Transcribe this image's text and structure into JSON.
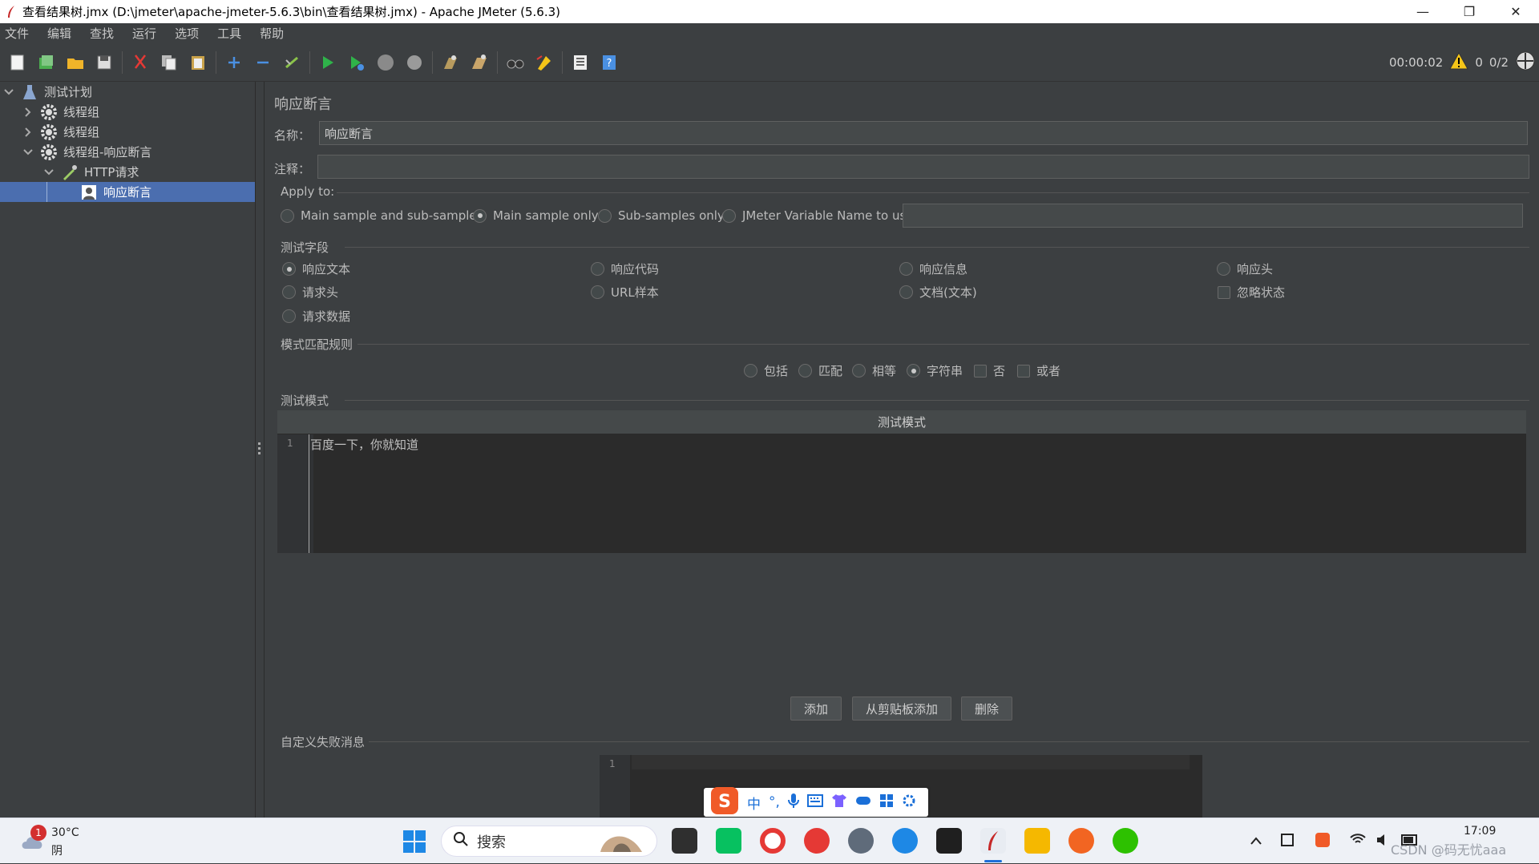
{
  "window": {
    "title": "查看结果树.jmx (D:\\jmeter\\apache-jmeter-5.6.3\\bin\\查看结果树.jmx) - Apache JMeter (5.6.3)",
    "minimize": "—",
    "maximize": "❐",
    "close": "✕"
  },
  "menu": [
    "文件",
    "编辑",
    "查找",
    "运行",
    "选项",
    "工具",
    "帮助"
  ],
  "toolbar_status": {
    "elapsed": "00:00:02",
    "warnings": "0",
    "threads": "0/2"
  },
  "tree": {
    "items": [
      {
        "label": "测试计划"
      },
      {
        "label": "线程组"
      },
      {
        "label": "线程组"
      },
      {
        "label": "线程组-响应断言"
      },
      {
        "label": "HTTP请求"
      },
      {
        "label": "响应断言"
      }
    ]
  },
  "panel": {
    "title": "响应断言",
    "name_label": "名称：",
    "name_value": "响应断言",
    "comment_label": "注释：",
    "comment_value": "",
    "apply_to": {
      "label": "Apply to:",
      "options": [
        "Main sample and sub-samples",
        "Main sample only",
        "Sub-samples only",
        "JMeter Variable Name to use"
      ],
      "selected": "Main sample only",
      "variable_value": ""
    },
    "fields": {
      "label": "测试字段",
      "options": [
        "响应文本",
        "响应代码",
        "响应信息",
        "响应头",
        "请求头",
        "URL样本",
        "文档(文本)",
        "忽略状态",
        "请求数据"
      ],
      "selected": "响应文本"
    },
    "pattern_rules": {
      "label": "模式匹配规则",
      "options": [
        "包括",
        "匹配",
        "相等",
        "字符串",
        "否",
        "或者"
      ],
      "selected": "字符串"
    },
    "patterns": {
      "label": "测试模式",
      "column": "测试模式",
      "line_no": "1",
      "value": "百度一下，你就知道"
    },
    "buttons": {
      "add": "添加",
      "add_clipboard": "从剪贴板添加",
      "delete": "删除"
    },
    "failure": {
      "label": "自定义失败消息",
      "line_no": "1",
      "value": ""
    }
  },
  "ime": {
    "mode": "中",
    "punct": "°,"
  },
  "taskbar": {
    "weather_temp": "30°C",
    "weather_desc": "阴",
    "weather_badge": "1",
    "search_placeholder": "搜索",
    "time": "17:09",
    "watermark": "CSDN @码无忧aaa"
  },
  "colors": {
    "bg": "#3c3f41",
    "selection": "#4b6eaf",
    "editor": "#2b2b2b"
  }
}
